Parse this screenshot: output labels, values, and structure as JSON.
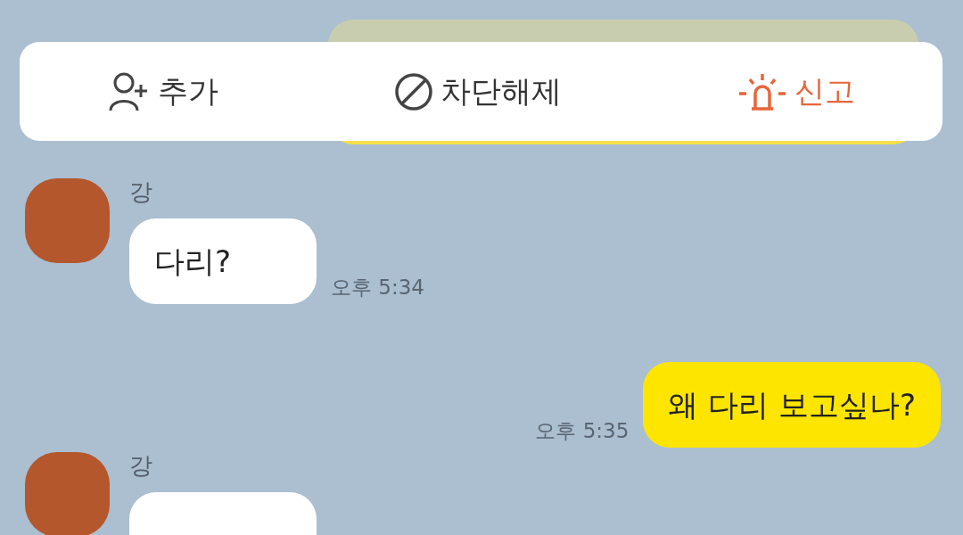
{
  "actions": [
    {
      "kind": "add",
      "label": "추가"
    },
    {
      "kind": "unblock",
      "label": "차단해제"
    },
    {
      "kind": "report",
      "label": "신고"
    }
  ],
  "messages": [
    {
      "kind": "received",
      "sender": "강",
      "text": "다리?",
      "time": "오후 5:34"
    },
    {
      "kind": "sent",
      "text": "왜 다리 보고싶나?",
      "time": "오후 5:35"
    },
    {
      "kind": "received",
      "sender": "강"
    }
  ]
}
